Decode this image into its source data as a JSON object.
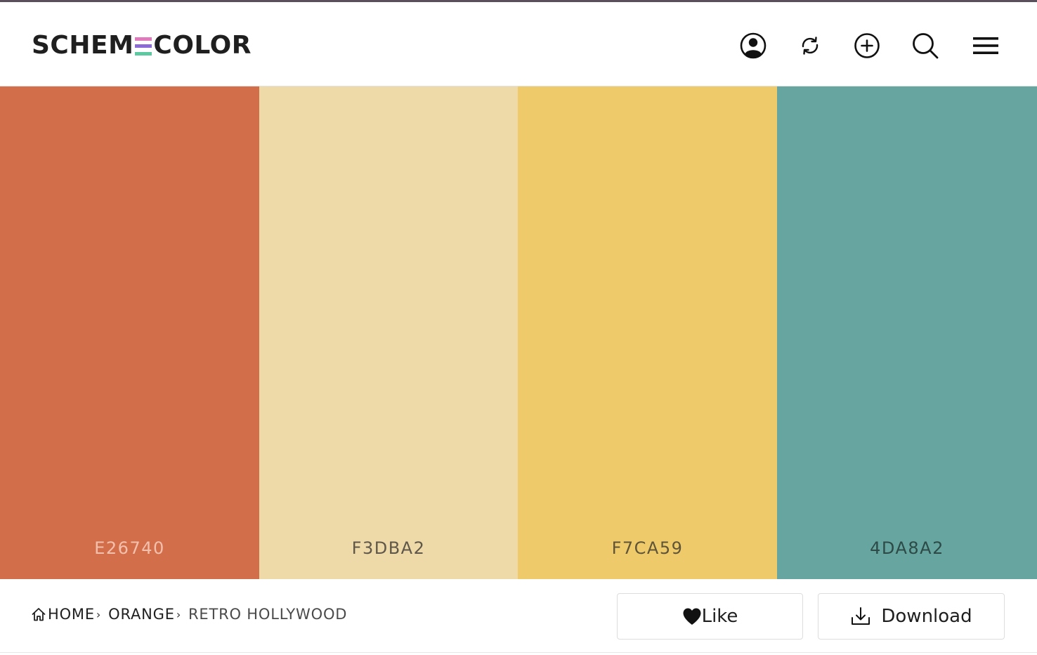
{
  "header": {
    "logo": {
      "left": "SCHEM",
      "right": "COLOR",
      "e_bars": [
        "#e07abd",
        "#8b6bd6",
        "#5ec8a0"
      ]
    },
    "icons": [
      "user-account-icon",
      "refresh-icon",
      "add-circle-icon",
      "search-icon",
      "menu-icon"
    ]
  },
  "palette": {
    "colors": [
      {
        "hex": "E26740",
        "display": "#D36E4B",
        "text_color": "#F2C1AE"
      },
      {
        "hex": "F3DBA2",
        "display": "#EEDAA8",
        "text_color": "#5F574A"
      },
      {
        "hex": "F7CA59",
        "display": "#EECA6B",
        "text_color": "#5F5437"
      },
      {
        "hex": "4DA8A2",
        "display": "#67A6A0",
        "text_color": "#2D4A47"
      }
    ]
  },
  "breadcrumb": {
    "home": "HOME",
    "category": "ORANGE",
    "current": "RETRO HOLLYWOOD",
    "separator": "›"
  },
  "actions": {
    "like_label": "Like",
    "download_label": "Download"
  }
}
